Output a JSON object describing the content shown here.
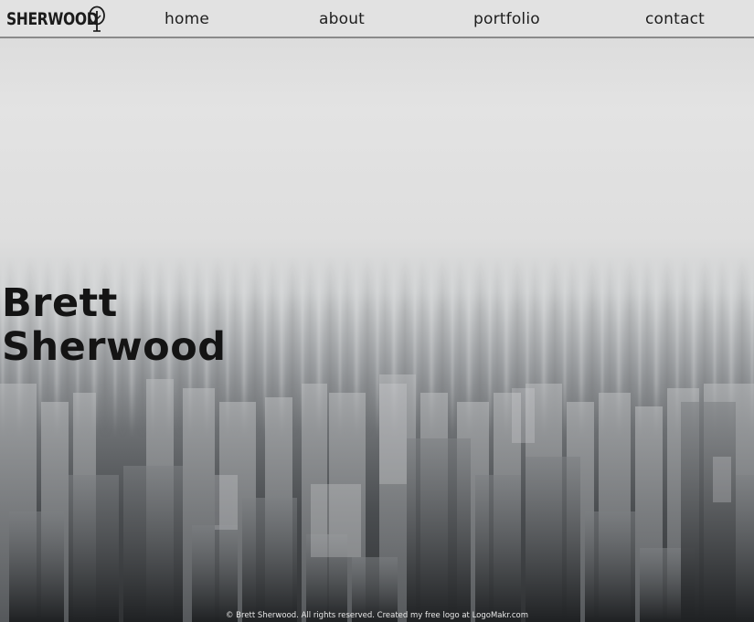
{
  "brand": {
    "logo_text": "SHERWOOD",
    "logo_icon": "tree-icon"
  },
  "nav": {
    "items": [
      {
        "label": "home"
      },
      {
        "label": "about"
      },
      {
        "label": "portfolio"
      },
      {
        "label": "contact"
      }
    ]
  },
  "hero": {
    "name_first": "Brett",
    "name_last": "Sherwood",
    "background": "foggy-city-skyline"
  },
  "footer": {
    "text": "© Brett Sherwood. All rights reserved. Created my free logo at LogoMakr.com"
  },
  "colors": {
    "nav_bg": "#e2e2e2",
    "nav_border": "#8a8a8a",
    "text_dark": "#141414",
    "footer_text": "#e9e9e9"
  }
}
